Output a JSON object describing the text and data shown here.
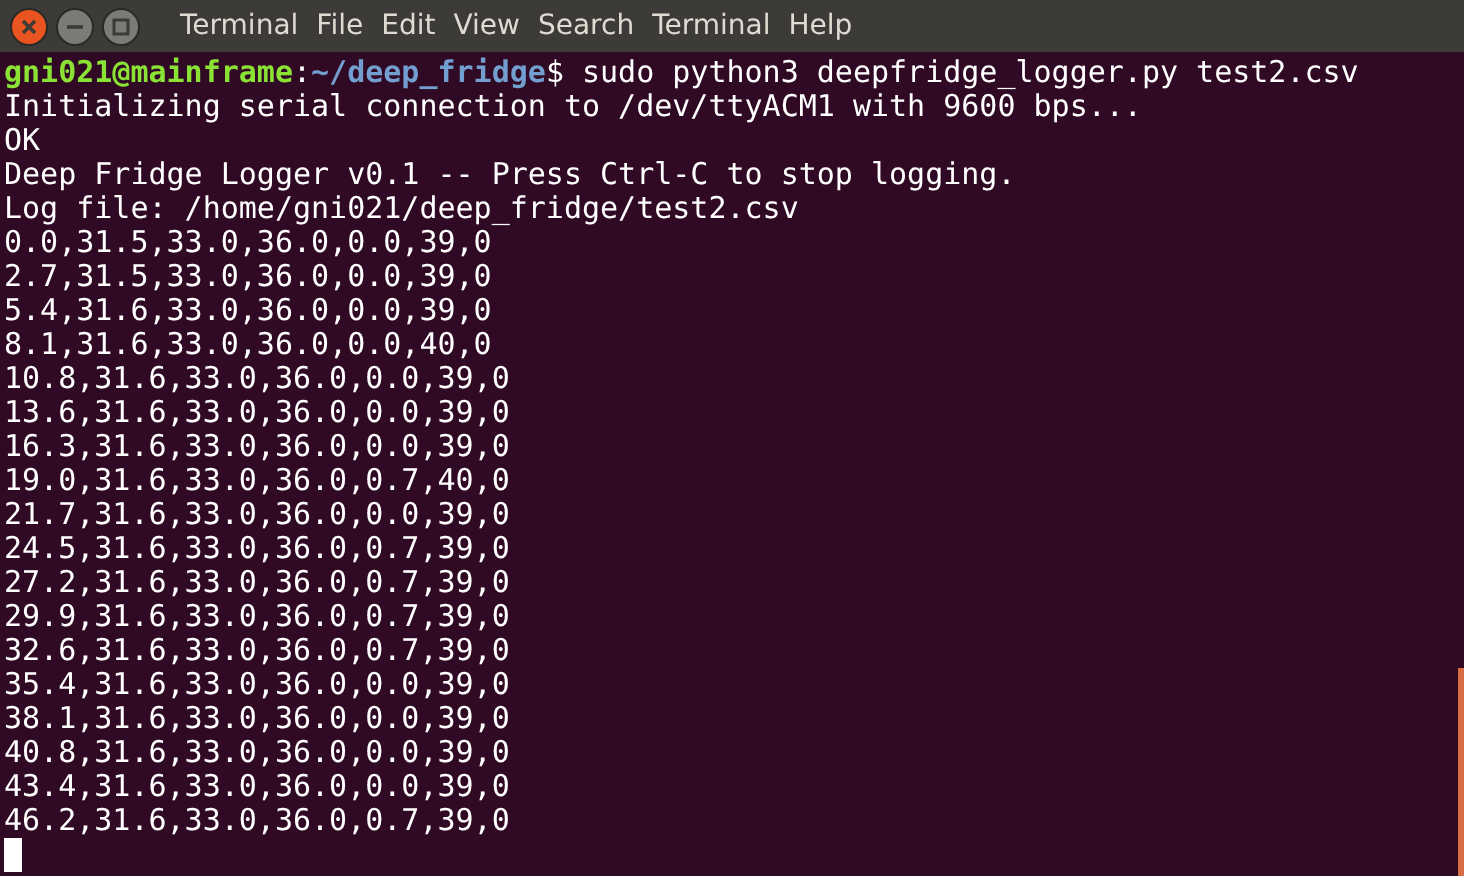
{
  "window": {
    "title": "Terminal"
  },
  "menu": [
    "File",
    "Edit",
    "View",
    "Search",
    "Terminal",
    "Help"
  ],
  "prompt": {
    "user_host": "gni021@mainframe",
    "separator": ":",
    "path": "~/deep_fridge",
    "symbol": "$",
    "command": "sudo python3 deepfridge_logger.py test2.csv"
  },
  "output_lines": [
    "Initializing serial connection to /dev/ttyACM1 with 9600 bps...",
    "OK",
    "Deep Fridge Logger v0.1 -- Press Ctrl-C to stop logging.",
    "Log file: /home/gni021/deep_fridge/test2.csv",
    "0.0,31.5,33.0,36.0,0.0,39,0",
    "2.7,31.5,33.0,36.0,0.0,39,0",
    "5.4,31.6,33.0,36.0,0.0,39,0",
    "8.1,31.6,33.0,36.0,0.0,40,0",
    "10.8,31.6,33.0,36.0,0.0,39,0",
    "13.6,31.6,33.0,36.0,0.0,39,0",
    "16.3,31.6,33.0,36.0,0.0,39,0",
    "19.0,31.6,33.0,36.0,0.7,40,0",
    "21.7,31.6,33.0,36.0,0.0,39,0",
    "24.5,31.6,33.0,36.0,0.7,39,0",
    "27.2,31.6,33.0,36.0,0.7,39,0",
    "29.9,31.6,33.0,36.0,0.7,39,0",
    "32.6,31.6,33.0,36.0,0.7,39,0",
    "35.4,31.6,33.0,36.0,0.0,39,0",
    "38.1,31.6,33.0,36.0,0.0,39,0",
    "40.8,31.6,33.0,36.0,0.0,39,0",
    "43.4,31.6,33.0,36.0,0.0,39,0",
    "46.2,31.6,33.0,36.0,0.7,39,0"
  ]
}
